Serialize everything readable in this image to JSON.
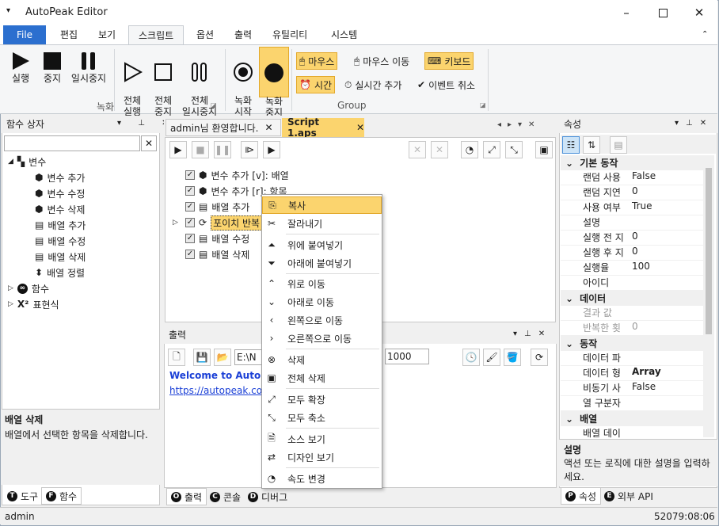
{
  "app": {
    "title": "AutoPeak Editor"
  },
  "ribbon": {
    "tabs": [
      "File",
      "편집",
      "보기",
      "스크립트",
      "옵션",
      "출력",
      "유틸리티",
      "시스템"
    ],
    "record_group": {
      "label": "녹화",
      "buttons": [
        "실행",
        "중지",
        "일시중지",
        "전체\n실행",
        "전체\n중지",
        "전체\n일시중지",
        "녹화\n시작",
        "녹화\n중지"
      ]
    },
    "group2": {
      "label": "Group",
      "items": [
        "마우스",
        "마우스 이동",
        "키보드",
        "시간",
        "실시간 추가",
        "이벤트 취소"
      ]
    }
  },
  "function_box": {
    "title": "함수 상자",
    "search_value": "",
    "tree": {
      "variables": "변수",
      "variable_children": [
        "변수 추가",
        "변수 수정",
        "변수 삭제",
        "배열 추가",
        "배열 수정",
        "배열 삭제",
        "배열 정렬"
      ],
      "functions": "함수",
      "expressions": "표현식"
    },
    "desc_title": "배열 삭제",
    "desc_text": "배열에서 선택한 항목을 삭제합니다.",
    "bottom_tabs": [
      {
        "key": "T",
        "label": "도구"
      },
      {
        "key": "F",
        "label": "함수"
      }
    ]
  },
  "editor": {
    "tabs": [
      "admin님 환영합니다.",
      "Script 1.aps"
    ],
    "rows": [
      "변수 추가 [v]: 배열",
      "변수 추가 [r]: 항목",
      "배열 추가",
      "포이치 반복",
      "배열 수정",
      "배열 삭제"
    ]
  },
  "output": {
    "title": "출력",
    "path_value": "E:\\N",
    "count_value": "1000",
    "lines": [
      "Welcome to AutoPeak",
      "https://autopeak.co"
    ],
    "bottom_tabs": [
      {
        "key": "O",
        "label": "출력"
      },
      {
        "key": "C",
        "label": "콘솔"
      },
      {
        "key": "D",
        "label": "디버그"
      }
    ]
  },
  "context_menu": {
    "items": [
      "복사",
      "잘라내기",
      "위에 붙여넣기",
      "아래에 붙여넣기",
      "위로 이동",
      "아래로 이동",
      "왼쪽으로 이동",
      "오른쪽으로 이동",
      "삭제",
      "전체 삭제",
      "모두 확장",
      "모두 축소",
      "소스 보기",
      "디자인 보기",
      "속도 변경"
    ]
  },
  "properties": {
    "title": "속성",
    "categories": [
      {
        "name": "기본 동작",
        "rows": [
          [
            "랜덤 사용",
            "False"
          ],
          [
            "랜덤 지연",
            "0"
          ],
          [
            "사용 여부",
            "True"
          ],
          [
            "설명",
            ""
          ],
          [
            "실행 전 지",
            "0"
          ],
          [
            "실행 후 지",
            "0"
          ],
          [
            "실행율",
            "100"
          ],
          [
            "아이디",
            ""
          ]
        ]
      },
      {
        "name": "데이터",
        "rows": [
          [
            "결과 값",
            ""
          ],
          [
            "반복한 횟",
            "0"
          ]
        ]
      },
      {
        "name": "동작",
        "rows": [
          [
            "데이터 파",
            ""
          ],
          [
            "데이터 형",
            "Array"
          ],
          [
            "비동기 사",
            "False"
          ],
          [
            "열 구분자",
            ""
          ]
        ]
      },
      {
        "name": "배열",
        "rows": [
          [
            "배열 데이",
            ""
          ]
        ]
      }
    ],
    "desc_title": "설명",
    "desc_text": "액션 또는 로직에 대한 설명을 입력하세요.",
    "bottom_tabs": [
      {
        "key": "P",
        "label": "속성"
      },
      {
        "key": "E",
        "label": "외부 API"
      }
    ]
  },
  "status": {
    "user": "admin",
    "time": "52079:08:06"
  },
  "colors": {
    "accent": "#2b6fcf",
    "highlight": "#fbd46e",
    "link": "#1a3fd6"
  }
}
